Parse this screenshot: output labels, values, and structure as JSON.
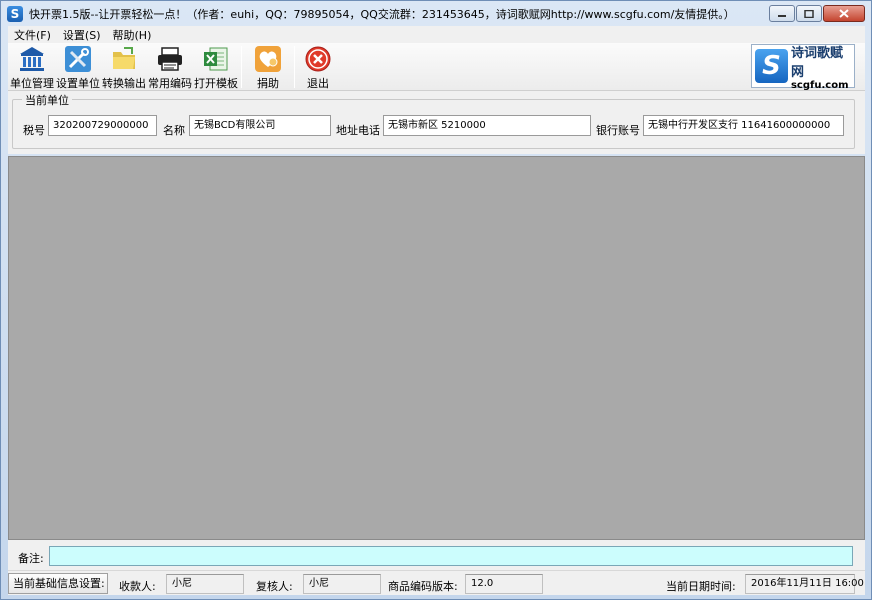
{
  "window": {
    "title": "快开票1.5版--让开票轻松一点！（作者：euhi，QQ：79895054，QQ交流群：231453645，诗词歌赋网http://www.scgfu.com/友情提供。）",
    "app_icon": "S",
    "minimize_icon": "minimize-icon",
    "maximize_icon": "maximize-icon",
    "close_icon": "close-icon"
  },
  "menu": {
    "items": [
      {
        "label": "文件(F)"
      },
      {
        "label": "设置(S)"
      },
      {
        "label": "帮助(H)"
      }
    ]
  },
  "toolbar": {
    "buttons": [
      {
        "label": "单位管理",
        "icon": "bank-building-icon"
      },
      {
        "label": "设置单位",
        "icon": "tools-icon"
      },
      {
        "label": "转换输出",
        "icon": "folder-icon"
      },
      {
        "label": "常用编码",
        "icon": "printer-icon"
      },
      {
        "label": "打开模板",
        "icon": "excel-icon"
      },
      {
        "label": "捐助",
        "icon": "donate-heart-icon"
      },
      {
        "label": "退出",
        "icon": "exit-icon"
      }
    ],
    "logo": {
      "badge": "S",
      "title": "诗词歌赋网",
      "url": "scgfu.com"
    }
  },
  "unit": {
    "legend": "当前单位",
    "tax_label": "税号",
    "tax_value": "320200729000000",
    "name_label": "名称",
    "name_value": "无锡BCD有限公司",
    "address_label": "地址电话",
    "address_value": "无锡市新区 5210000",
    "bank_label": "银行账号",
    "bank_value": "无锡中行开发区支行 11641600000000"
  },
  "notes": {
    "label": "备注:",
    "value": ""
  },
  "status": {
    "settings_button": "当前基础信息设置:",
    "payee_label": "收款人:",
    "payee_value": "小尼",
    "reviewer_label": "复核人:",
    "reviewer_value": "小尼",
    "code_version_label": "商品编码版本:",
    "code_version_value": "12.0",
    "datetime_label": "当前日期时间:",
    "datetime_value": "2016年11月11日 16:00"
  },
  "colors": {
    "main_area": "#a9a9a9",
    "notes_input": "#ccfdfd",
    "window_chrome": "#c4d6ec"
  }
}
